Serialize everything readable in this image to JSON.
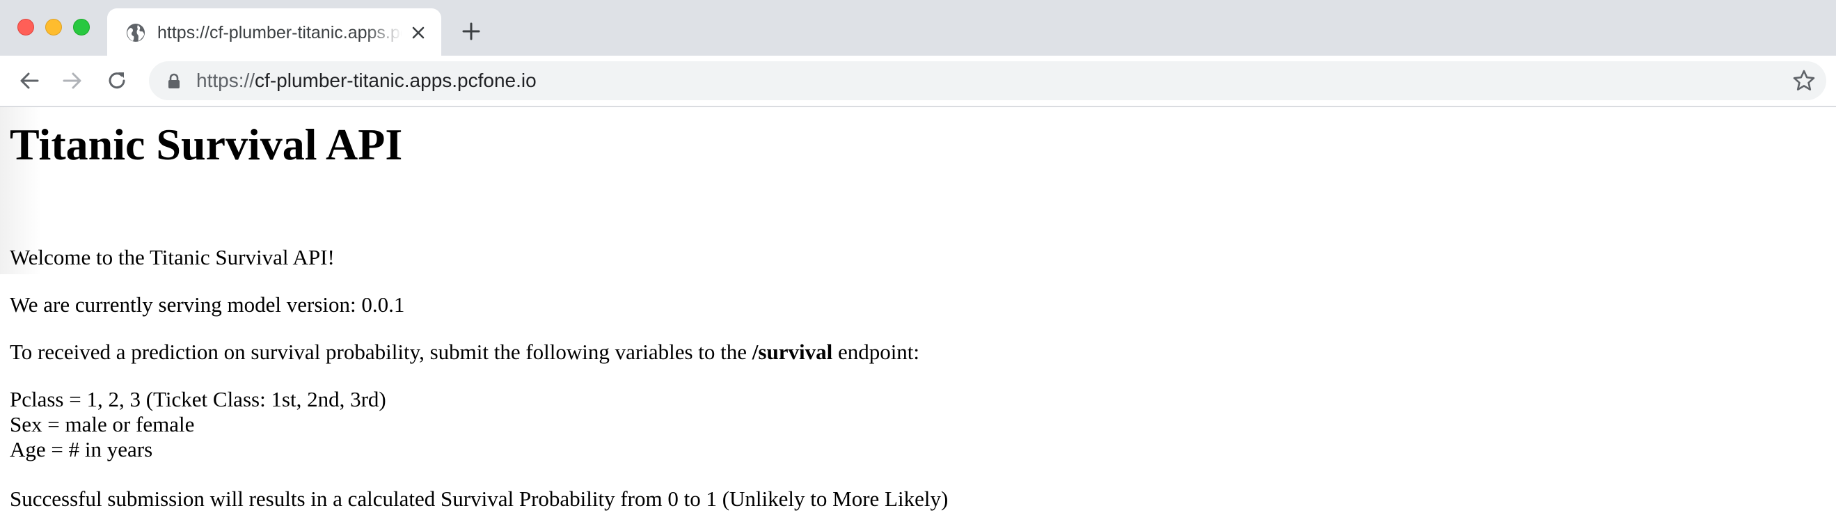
{
  "browser": {
    "tab": {
      "title": "https://cf-plumber-titanic.apps.pcfone.io"
    },
    "address_bar": {
      "scheme": "https://",
      "host": "cf-plumber-titanic.apps.pcfone.io"
    }
  },
  "page": {
    "heading": "Titanic Survival API",
    "welcome": "Welcome to the Titanic Survival API!",
    "model_version": "We are currently serving model version: 0.0.1",
    "instructions": {
      "before": "To received a prediction on survival probability, submit the following variables to the ",
      "endpoint": "/survival",
      "after": " endpoint:"
    },
    "variables": [
      "Pclass = 1, 2, 3 (Ticket Class: 1st, 2nd, 3rd)",
      "Sex = male or female",
      "Age = # in years"
    ],
    "result": "Successful submission will results in a calculated Survival Probability from 0 to 1 (Unlikely to More Likely)"
  }
}
